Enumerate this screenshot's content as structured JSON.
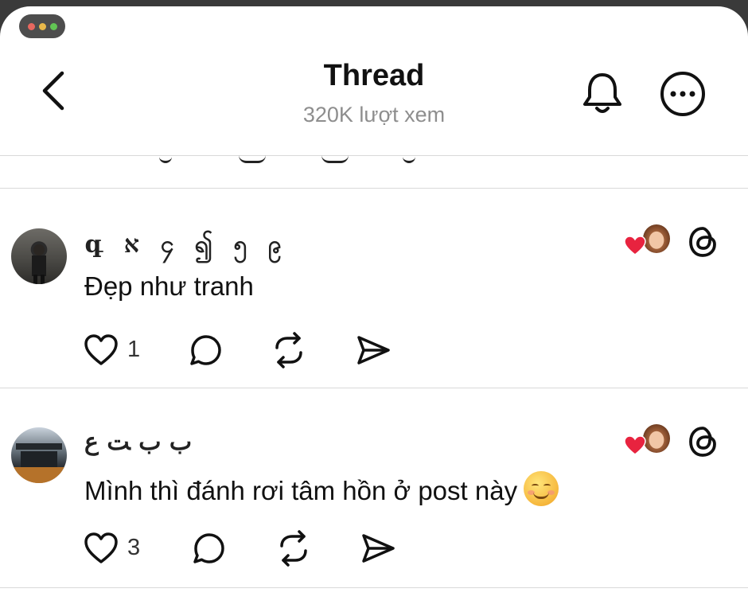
{
  "header": {
    "title": "Thread",
    "views": "320K lượt xem"
  },
  "comments": [
    {
      "username": "գ ﬡ ၄ ၍ ၅ ၉",
      "text": "Đẹp như tranh",
      "likes": "1"
    },
    {
      "username": "ب ﺏ ﺖ ﻉ",
      "text": "Mình thì đánh rơi tâm hồn ở post này",
      "likes": "3"
    }
  ],
  "colors": {
    "heart_red": "#e8233f",
    "muted_gray": "#8e8e8e"
  },
  "icons": [
    "back-chevron-icon",
    "bell-icon",
    "more-icon",
    "heart-icon",
    "reply-icon",
    "repost-icon",
    "share-icon",
    "threads-icon"
  ]
}
